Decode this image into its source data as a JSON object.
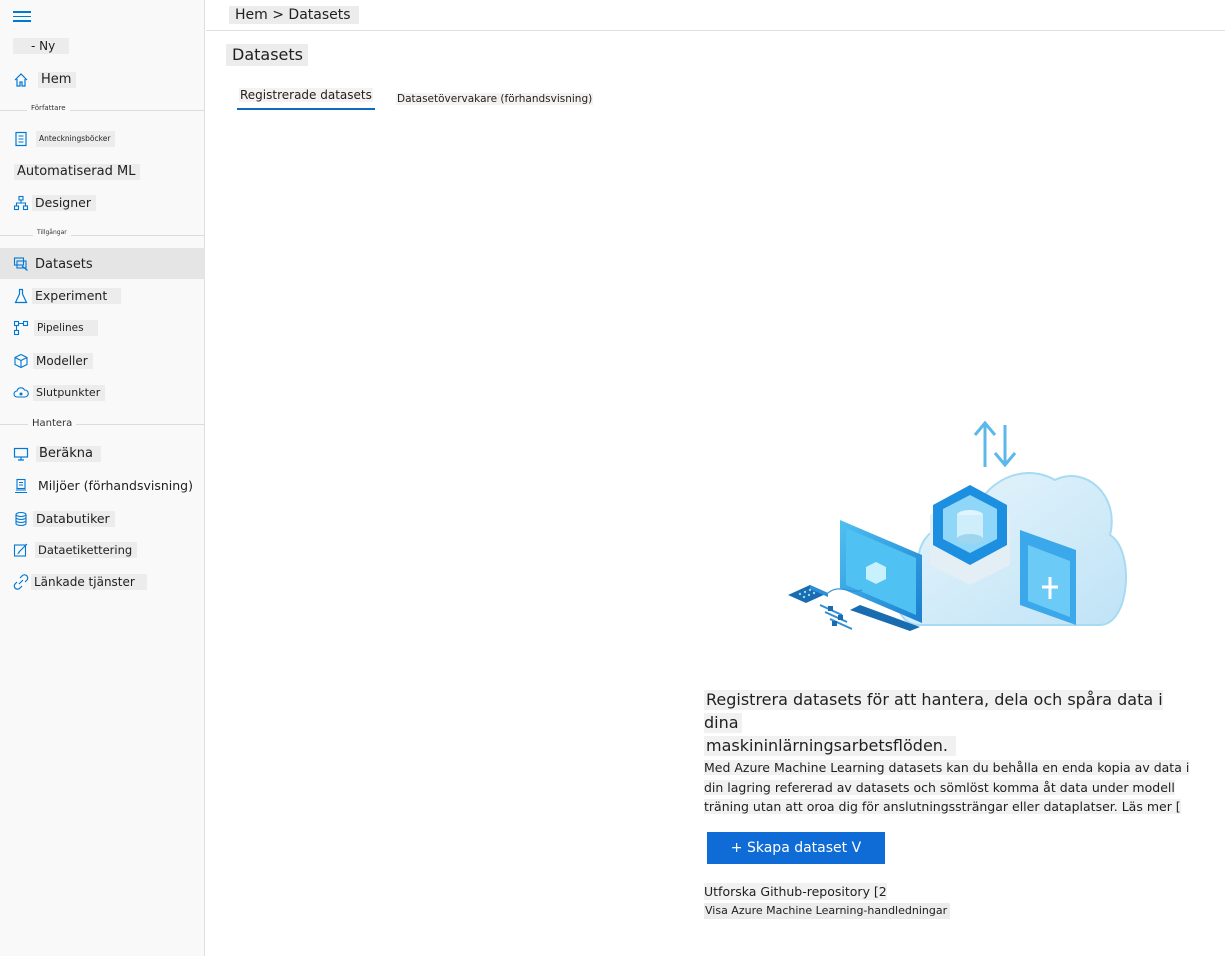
{
  "sidebar": {
    "new_label": "- Ny",
    "home_label": "Hem",
    "sections": {
      "author": "Författare",
      "assets": "Tillgångar",
      "manage": "Hantera"
    },
    "items": {
      "notebooks": "Anteckningsböcker",
      "automl": "Automatiserad ML",
      "designer": "Designer",
      "datasets": "Datasets",
      "experiments": "Experiment",
      "pipelines": "Pipelines",
      "models": "Modeller",
      "endpoints": "Slutpunkter",
      "compute": "Beräkna",
      "environments": "Miljöer (förhandsvisning)",
      "datastores": "Databutiker",
      "labeling": "Dataetikettering",
      "linked": "Länkade tjänster"
    }
  },
  "header": {
    "breadcrumb": "Hem > Datasets"
  },
  "main": {
    "title": "Datasets",
    "tabs": [
      {
        "label": "Registrerade datasets",
        "active": true
      },
      {
        "label": "Datasetövervakare (förhandsvisning)",
        "active": false
      }
    ],
    "empty_state": {
      "headline_line1": "Registrera datasets för att hantera, dela och spåra data i dina",
      "headline_line2": "maskininlärningsarbetsflöden.",
      "desc_line1": "Med Azure Machine Learning datasets kan du behålla en enda kopia av data i",
      "desc_line2": "din lagring refererad av datasets och sömlöst komma åt data under modell",
      "desc_line3": "träning utan att oroa dig för anslutningssträngar eller dataplatser. Läs mer [",
      "create_button": "+ Skapa dataset V",
      "github_link": "Utforska Github-repository [2",
      "tutorials_link": "Visa Azure Machine Learning-handledningar"
    }
  },
  "colors": {
    "accent": "#0f6cd6",
    "sidebar_bg": "#f9f9f9",
    "active_item_bg": "#e5e5e5"
  }
}
